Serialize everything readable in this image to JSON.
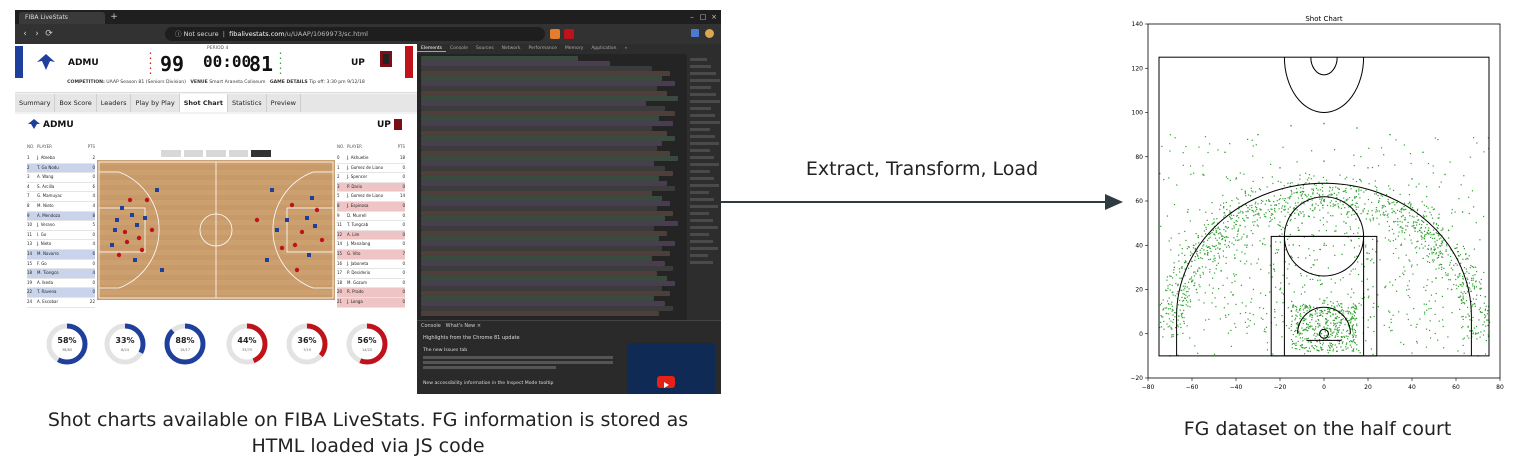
{
  "browser": {
    "tab_title": "FIBA LiveStats",
    "new_tab": "+",
    "win_controls": [
      "–",
      "□",
      "×"
    ],
    "nav_icons": [
      "‹",
      "›",
      "⟳"
    ],
    "url_security": "Not secure",
    "url_host": "fibalivestats.com",
    "url_path": "/u/UAAP/1069973/sc.html"
  },
  "fiba": {
    "home_team": "ADMU",
    "away_team": "UP",
    "home_score": "99",
    "away_score": "81",
    "period": "PERIOD 4",
    "clock": "00:00",
    "game_info_competition_label": "COMPETITION:",
    "game_info_competition": "UAAP Season 81 (Seniors Division)",
    "game_info_venue_label": "VENUE",
    "game_info_venue": "Smart Araneta Coliseum",
    "game_info_details_label": "GAME DETAILS",
    "game_info_details": "Tip off: 3:30 pm 9/12/18",
    "tabs": [
      "Summary",
      "Box Score",
      "Leaders",
      "Play by Play",
      "Shot Chart",
      "Statistics",
      "Preview"
    ],
    "active_tab": "Shot Chart",
    "roster_header_no": "NO.",
    "roster_header_player": "PLAYER",
    "roster_header_pts": "PTS",
    "home_roster": [
      {
        "no": "1",
        "name": "J. Ateeba",
        "pts": "2",
        "hl": false
      },
      {
        "no": "2",
        "name": "T. Go Nodu",
        "pts": "0",
        "hl": true
      },
      {
        "no": "3",
        "name": "A. Wang",
        "pts": "0",
        "hl": false
      },
      {
        "no": "4",
        "name": "S. Arcilla",
        "pts": "6",
        "hl": false
      },
      {
        "no": "7",
        "name": "G. Mamuyac",
        "pts": "4",
        "hl": false
      },
      {
        "no": "8",
        "name": "M. Nieto",
        "pts": "4",
        "hl": false
      },
      {
        "no": "9",
        "name": "A. Mendoza",
        "pts": "8",
        "hl": true
      },
      {
        "no": "10",
        "name": "J. Verano",
        "pts": "5",
        "hl": false
      },
      {
        "no": "11",
        "name": "I. Go",
        "pts": "0",
        "hl": false
      },
      {
        "no": "13",
        "name": "J. Nieto",
        "pts": "4",
        "hl": false
      },
      {
        "no": "14",
        "name": "M. Navarro",
        "pts": "6",
        "hl": true
      },
      {
        "no": "15",
        "name": "F. Go",
        "pts": "0",
        "hl": false
      },
      {
        "no": "18",
        "name": "M. Tiongco",
        "pts": "4",
        "hl": true
      },
      {
        "no": "19",
        "name": "A. Ikeda",
        "pts": "0",
        "hl": false
      },
      {
        "no": "22",
        "name": "T. Ravena",
        "pts": "0",
        "hl": true
      },
      {
        "no": "24",
        "name": "A. Escobar",
        "pts": "22",
        "hl": false
      }
    ],
    "away_roster": [
      {
        "no": "0",
        "name": "J. Akhuetie",
        "pts": "18",
        "hl": false
      },
      {
        "no": "1",
        "name": "J. Gomez de Liano",
        "pts": "0",
        "hl": false
      },
      {
        "no": "2",
        "name": "J. Spencer",
        "pts": "0",
        "hl": false
      },
      {
        "no": "3",
        "name": "P. Dario",
        "pts": "0",
        "hl": true
      },
      {
        "no": "5",
        "name": "J. Gomez de Liano",
        "pts": "14",
        "hl": false
      },
      {
        "no": "8",
        "name": "J. Espinosa",
        "pts": "0",
        "hl": true
      },
      {
        "no": "9",
        "name": "D. Murrell",
        "pts": "0",
        "hl": false
      },
      {
        "no": "11",
        "name": "T. Tungcab",
        "pts": "0",
        "hl": false
      },
      {
        "no": "12",
        "name": "A. Lim",
        "pts": "0",
        "hl": true
      },
      {
        "no": "14",
        "name": "J. Manalang",
        "pts": "0",
        "hl": false
      },
      {
        "no": "15",
        "name": "G. Vito",
        "pts": "7",
        "hl": true
      },
      {
        "no": "16",
        "name": "J. Jaboneta",
        "pts": "0",
        "hl": false
      },
      {
        "no": "17",
        "name": "P. Desiderio",
        "pts": "0",
        "hl": false
      },
      {
        "no": "18",
        "name": "M. Gozum",
        "pts": "0",
        "hl": false
      },
      {
        "no": "20",
        "name": "R. Prado",
        "pts": "0",
        "hl": true
      },
      {
        "no": "21",
        "name": "J. Longa",
        "pts": "0",
        "hl": true
      }
    ],
    "home_pcts": [
      "58%",
      "33%",
      "88%"
    ],
    "home_pct_subs": [
      "38/65",
      "8/24",
      "15/17"
    ],
    "away_pcts": [
      "44%",
      "36%",
      "56%"
    ],
    "away_pct_subs": [
      "33/75",
      "7/19",
      "14/25"
    ],
    "home_pct_fill": [
      0.58,
      0.33,
      0.88
    ],
    "away_pct_fill": [
      0.44,
      0.36,
      0.56
    ],
    "home_color": "#1e3f9c",
    "away_color": "#c0121a"
  },
  "devtools": {
    "tabs": [
      "Elements",
      "Console",
      "Sources",
      "Network",
      "Performance",
      "Memory",
      "Application",
      "»"
    ],
    "active_tab": "Elements",
    "console_tabs": [
      "Console",
      "What's New ×"
    ],
    "console_header": "Highlights from the Chrome 81 update",
    "console_items": [
      "The new Issues tab",
      "New accessibility information in the Inspect Mode tooltip"
    ]
  },
  "diagram": {
    "arrow_label": "Extract, Transform, Load",
    "caption_left_line1": "Shot charts available on FIBA LiveStats. FG information is stored as",
    "caption_left_line2": "HTML loaded via JS code",
    "caption_right": "FG dataset on the half court"
  },
  "chart_data": {
    "type": "scatter",
    "title": "Shot Chart",
    "xlabel": "",
    "ylabel": "",
    "xlim": [
      -80,
      80
    ],
    "ylim": [
      -20,
      140
    ],
    "xticks": [
      -80,
      -60,
      -40,
      -20,
      0,
      20,
      40,
      60,
      80
    ],
    "yticks": [
      -20,
      0,
      20,
      40,
      60,
      80,
      100,
      120,
      140
    ],
    "point_color": "#2ca02c",
    "grid": false,
    "court_lines_color": "#000000",
    "series": [
      {
        "values": [
          [
            -70,
            -10
          ],
          [
            -66,
            8
          ],
          [
            -68,
            30
          ],
          [
            -62,
            55
          ],
          [
            -55,
            72
          ],
          [
            -45,
            82
          ],
          [
            -30,
            90
          ],
          [
            -15,
            94
          ],
          [
            0,
            95
          ],
          [
            15,
            93
          ],
          [
            30,
            90
          ],
          [
            45,
            82
          ],
          [
            55,
            72
          ],
          [
            63,
            55
          ],
          [
            68,
            30
          ],
          [
            66,
            8
          ],
          [
            70,
            -10
          ],
          [
            -5,
            2
          ],
          [
            0,
            3
          ],
          [
            5,
            2
          ],
          [
            -3,
            8
          ],
          [
            3,
            8
          ],
          [
            -8,
            12
          ],
          [
            8,
            12
          ],
          [
            0,
            15
          ],
          [
            -12,
            5
          ],
          [
            12,
            5
          ],
          [
            -2,
            0
          ],
          [
            2,
            0
          ],
          [
            -20,
            20
          ],
          [
            20,
            20
          ],
          [
            -15,
            35
          ],
          [
            15,
            35
          ],
          [
            0,
            40
          ],
          [
            -10,
            50
          ],
          [
            10,
            50
          ],
          [
            0,
            60
          ],
          [
            -25,
            60
          ],
          [
            25,
            60
          ],
          [
            -35,
            40
          ],
          [
            35,
            40
          ],
          [
            -50,
            45
          ],
          [
            50,
            45
          ],
          [
            -58,
            20
          ],
          [
            58,
            20
          ],
          [
            -40,
            70
          ],
          [
            40,
            70
          ],
          [
            -20,
            75
          ],
          [
            20,
            75
          ],
          [
            0,
            78
          ]
        ]
      }
    ]
  }
}
